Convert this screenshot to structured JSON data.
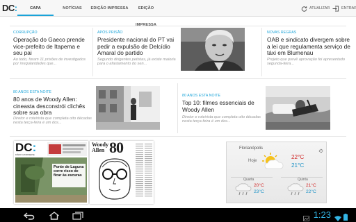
{
  "app": {
    "logo_text": "DC",
    "logo_colon": ":",
    "tabs": [
      {
        "label": "CAPA",
        "active": true
      },
      {
        "label": "NOTÍCIAS",
        "active": false
      },
      {
        "label": "EDIÇÃO IMPRESSA",
        "active": false
      },
      {
        "label": "EDIÇÃO IMPRESSA",
        "active": false
      }
    ],
    "refresh_label": "ATUALIZAR",
    "login_label": "ENTRAR",
    "accent_color": "#1aa3d8"
  },
  "articles": [
    {
      "kicker": "CORRUPÇÃO",
      "headline": "Operação do Gaeco prende vice-prefeito de Itapema e seu pai",
      "lead": "Ao todo, foram 11 prisões de investigados por irregularidades que..."
    },
    {
      "kicker": "APÓS PRISÃO",
      "headline": "Presidente nacional do PT vai pedir a expulsão de Delcídio Amaral do partido",
      "lead": "Segundo dirigentes petistas, já existe maioria para o afastamento do sen..."
    },
    {
      "kicker": "NOVAS REGRAS",
      "headline": "OAB e sindicato divergem sobre a lei que regulamenta serviço de táxi em Blumenau",
      "lead": "Projeto que prevê aprovação foi apresentado segunda-feira..."
    },
    {
      "kicker": "80 ANOS ESTA NOITE",
      "headline": "80 anos de Woody Allen: cineasta desconstrói clichês sobre sua obra",
      "lead": "Diretor e roteirista que completa oito décadas nesta terça-feira é um dos..."
    },
    {
      "kicker": "80 ANOS ESTA NOITE",
      "headline": "Top 10: filmes essenciais de Woody Allen",
      "lead": "Diretor e roteirista que completa oito décadas nesta terça-feira é um dos..."
    }
  ],
  "covers": [
    {
      "masthead": "DC",
      "masthead_colon": ":",
      "subtitle": "DIÁRIO CATARINENSE",
      "headline": "Ponte de Laguna corre risco de ficar às escuras"
    },
    {
      "title_line1": "Woody",
      "title_line2": "Allen",
      "big_number": "80"
    }
  ],
  "weather": {
    "city": "Florianópolis",
    "today": {
      "label": "Hoje",
      "max": "22°C",
      "min": "21°C"
    },
    "forecast": [
      {
        "day": "Quarta",
        "max": "20°C",
        "min": "23°C"
      },
      {
        "day": "Quinta",
        "max": "21°C",
        "min": "22°C"
      }
    ],
    "max_color": "#d12a2a",
    "min_color": "#1d92c6"
  },
  "system_bar": {
    "clock": "1:23"
  }
}
